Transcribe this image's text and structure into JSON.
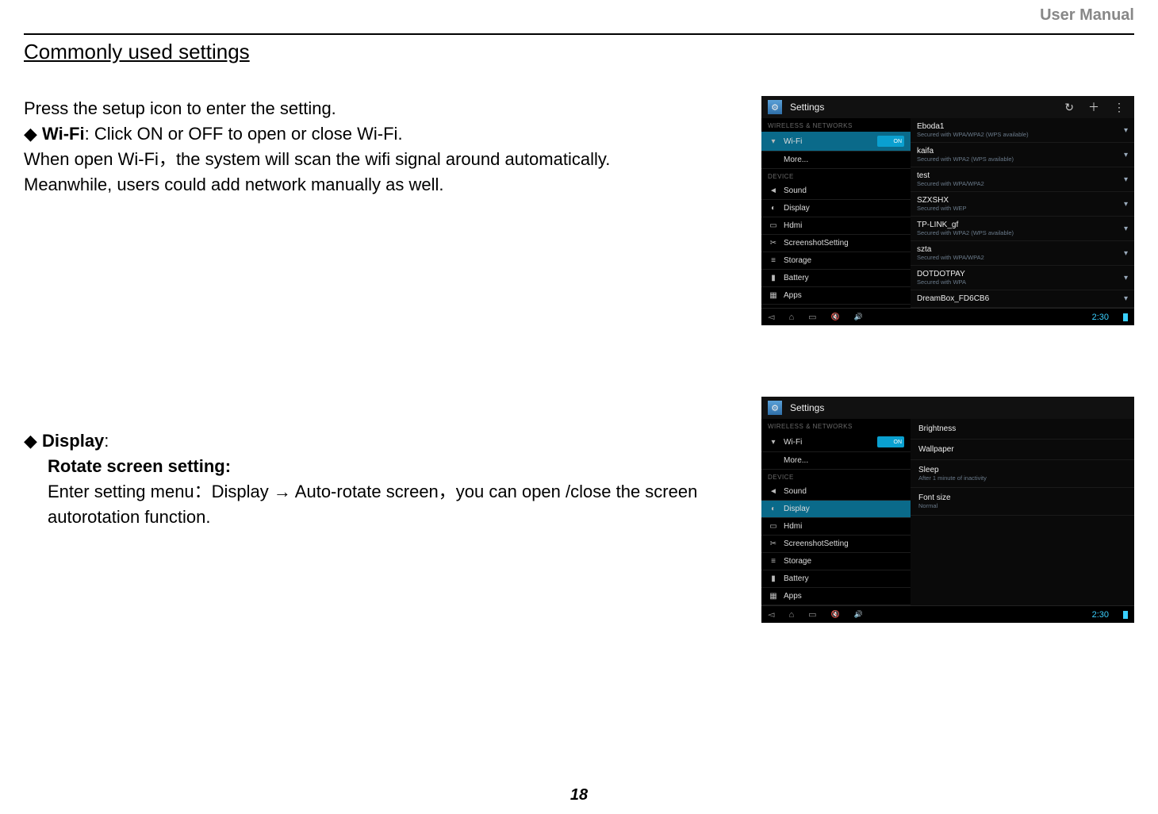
{
  "header": {
    "label": "User Manual"
  },
  "section_title": "Commonly used settings",
  "intro": "Press the setup icon to enter the setting.",
  "wifi_item": {
    "label": "Wi-Fi",
    "desc": ": Click ON or OFF to open or close Wi-Fi."
  },
  "wifi_para1": "When open Wi-Fi，the system will scan the wifi signal around automatically.",
  "wifi_para2": "Meanwhile, users could add network manually as well.",
  "display_item": {
    "label": "Display",
    "colon": ":"
  },
  "rotate_title": "Rotate screen setting:",
  "rotate_desc_1": "Enter setting menu：Display ",
  "rotate_arrow": "→",
  "rotate_desc_2": " Auto-rotate screen，you can open /close the screen autorotation function.",
  "page_number": "18",
  "shot1": {
    "app_title": "Settings",
    "ab_icons": [
      "↻",
      "＋",
      "⋮"
    ],
    "cat_wireless": "WIRELESS & NETWORKS",
    "cat_device": "DEVICE",
    "toggle": "ON",
    "left_rows": [
      {
        "icon": "▾",
        "label": "Wi-Fi",
        "sel": true,
        "toggle": true
      },
      {
        "icon": "",
        "label": "More...",
        "sel": false
      },
      {
        "icon": "◄",
        "label": "Sound",
        "sel": false,
        "cat": "DEVICE"
      },
      {
        "icon": "◐",
        "label": "Display",
        "sel": false
      },
      {
        "icon": "▭",
        "label": "Hdmi",
        "sel": false
      },
      {
        "icon": "✂",
        "label": "ScreenshotSetting",
        "sel": false
      },
      {
        "icon": "≡",
        "label": "Storage",
        "sel": false
      },
      {
        "icon": "▮",
        "label": "Battery",
        "sel": false
      },
      {
        "icon": "▦",
        "label": "Apps",
        "sel": false
      }
    ],
    "networks": [
      {
        "name": "Eboda1",
        "sub": "Secured with WPA/WPA2 (WPS available)"
      },
      {
        "name": "kaifa",
        "sub": "Secured with WPA2 (WPS available)"
      },
      {
        "name": "test",
        "sub": "Secured with WPA/WPA2"
      },
      {
        "name": "SZXSHX",
        "sub": "Secured with WEP"
      },
      {
        "name": "TP-LINK_gf",
        "sub": "Secured with WPA2 (WPS available)"
      },
      {
        "name": "szta",
        "sub": "Secured with WPA/WPA2"
      },
      {
        "name": "DOTDOTPAY",
        "sub": "Secured with WPA"
      },
      {
        "name": "DreamBox_FD6CB6",
        "sub": ""
      }
    ],
    "clock": "2:30"
  },
  "shot2": {
    "app_title": "Settings",
    "cat_wireless": "WIRELESS & NETWORKS",
    "cat_device": "DEVICE",
    "toggle": "ON",
    "left_rows": [
      {
        "icon": "▾",
        "label": "Wi-Fi",
        "sel": false,
        "toggle": true
      },
      {
        "icon": "",
        "label": "More...",
        "sel": false
      },
      {
        "icon": "◄",
        "label": "Sound",
        "sel": false,
        "cat": "DEVICE"
      },
      {
        "icon": "◐",
        "label": "Display",
        "sel": true
      },
      {
        "icon": "▭",
        "label": "Hdmi",
        "sel": false
      },
      {
        "icon": "✂",
        "label": "ScreenshotSetting",
        "sel": false
      },
      {
        "icon": "≡",
        "label": "Storage",
        "sel": false
      },
      {
        "icon": "▮",
        "label": "Battery",
        "sel": false
      },
      {
        "icon": "▦",
        "label": "Apps",
        "sel": false
      }
    ],
    "display_options": [
      {
        "name": "Brightness",
        "sub": ""
      },
      {
        "name": "Wallpaper",
        "sub": ""
      },
      {
        "name": "Sleep",
        "sub": "After 1 minute of inactivity"
      },
      {
        "name": "Font size",
        "sub": "Normal"
      }
    ],
    "clock": "2:30"
  }
}
